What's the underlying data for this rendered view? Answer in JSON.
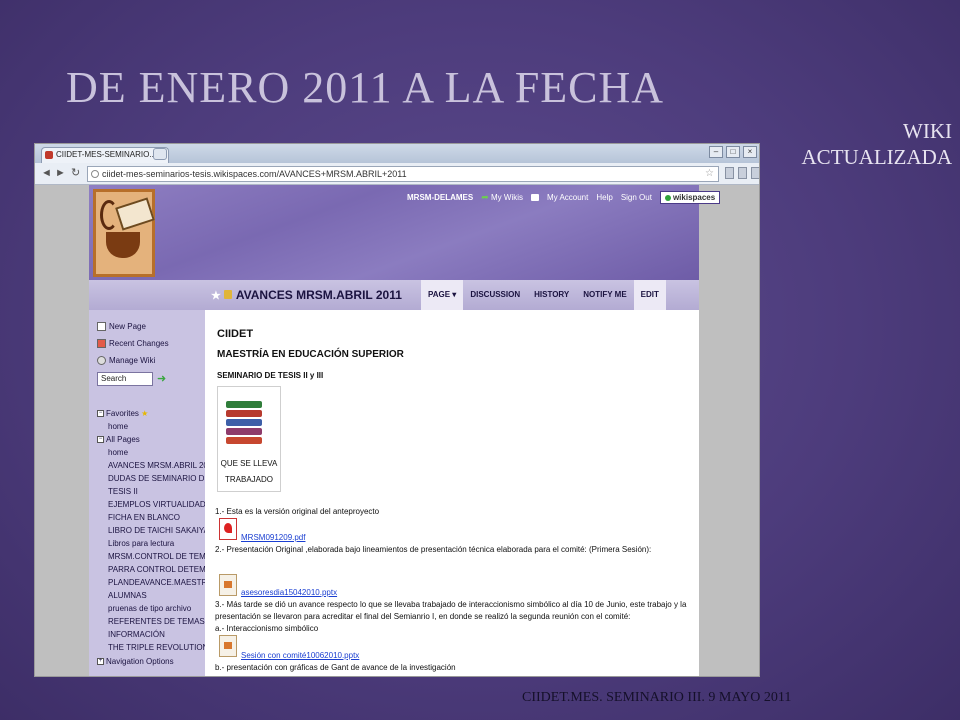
{
  "slide": {
    "title": "DE ENERO 2011 A LA FECHA",
    "side_label": "WIKI ACTUALIZADA",
    "footer": "CIIDET.MES. SEMINARIO  III. 9 MAYO 2011"
  },
  "browser": {
    "tab_title": "CIIDET-MES-SEMINARIO...",
    "tab_close": "×",
    "url": "ciidet-mes-seminarios-tesis.wikispaces.com/AVANCES+MRSM.ABRIL+2011",
    "nav": {
      "back": "◄",
      "forward": "►",
      "reload": "↻"
    },
    "window_buttons": [
      "–",
      "□",
      "×"
    ],
    "star": "☆"
  },
  "wiki": {
    "userbar": {
      "username": "MRSM-DELAMES",
      "my_wikis": "My Wikis",
      "my_account": "My Account",
      "help": "Help",
      "sign_out": "Sign Out",
      "brand": "wikispaces"
    },
    "page_title": "AVANCES MRSM.ABRIL 2011",
    "tabs": [
      "PAGE ▾",
      "DISCUSSION",
      "HISTORY",
      "NOTIFY ME",
      "EDIT"
    ],
    "sidebar": {
      "new_page": "New Page",
      "recent_changes": "Recent Changes",
      "manage_wiki": "Manage Wiki",
      "search_value": "Search",
      "favorites": "Favorites",
      "favorites_items": [
        "home"
      ],
      "all_pages": "All Pages",
      "pages": [
        "home",
        "AVANCES MRSM.ABRIL 20",
        "DUDAS DE SEMINARIO DE",
        "TESIS II",
        "EJEMPLOS VIRTUALIDAD",
        "FICHA EN BLANCO",
        "LIBRO DE TAICHI SAKAIYA",
        "Libros para lectura",
        "MRSM.CONTROL DE TEMA",
        "PARRA CONTROL DETEMA",
        "PLANDEAVANCE.MAESTRO",
        "ALUMNAS",
        "pruenas de tipo archivo",
        "REFERENTES DE TEMAS E",
        "INFORMACIÓN",
        "THE TRIPLE REVOLUTION"
      ],
      "navigation_options": "Navigation Options"
    },
    "content": {
      "h1": "CIIDET",
      "h2": "MAESTRÍA EN EDUCACIÓN SUPERIOR",
      "h3": "SEMINARIO DE TESIS II y III",
      "image_caption_1": "QUE SE LLEVA",
      "image_caption_2": "TRABAJADO",
      "item1": "1.- Esta es la versión original del anteproyecto",
      "file1": "MRSM091209.pdf",
      "item2": "2.- Presentación Original ,elaborada bajo lineamientos de presentación técnica elaborada para el comité: (Primera Sesión):",
      "file2": "asesoresdia15042010.pptx",
      "item3a": "3.- Más tarde se dió un avance respecto lo que se llevaba trabajado de interaccionismo simbólico al día 10 de Junio, este trabajo y la",
      "item3b": "presentación se llevaron para acreditar el final del Semianrio I, en donde se realizó la segunda reunión con el comité:",
      "item3c": "a.- Interaccionismo simbólico",
      "file3": "Sesión con comité10062010.pptx",
      "item3d": "b.- presentación con gráficas de Gant de avance de la investigación"
    }
  }
}
